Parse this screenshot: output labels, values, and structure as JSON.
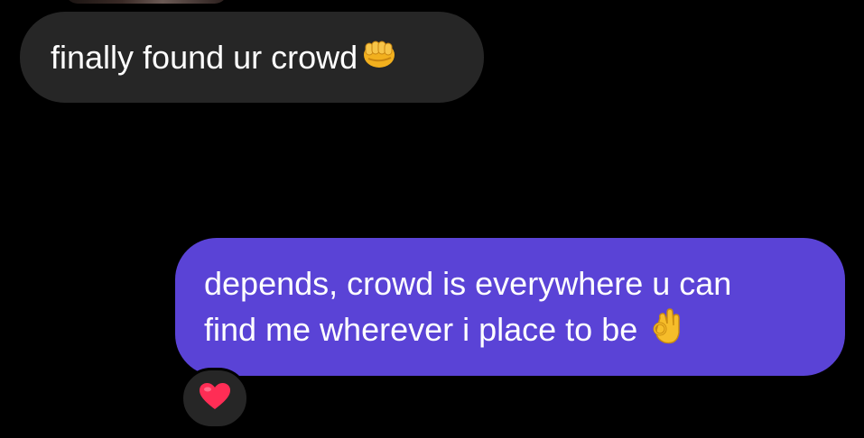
{
  "messages": [
    {
      "direction": "incoming",
      "text": "finally found ur crowd",
      "emoji_icon": "fist-bump-icon"
    },
    {
      "direction": "outgoing",
      "lines": [
        "depends, crowd is everywhere u can",
        "find me wherever i place to be"
      ],
      "emoji_icon": "ok-hand-icon",
      "reaction_icon": "red-heart-icon"
    }
  ],
  "colors": {
    "background": "#000000",
    "incoming_bubble": "#262626",
    "outgoing_bubble": "#5a43d6",
    "text": "#ffffff",
    "heart": "#ff2d55"
  }
}
